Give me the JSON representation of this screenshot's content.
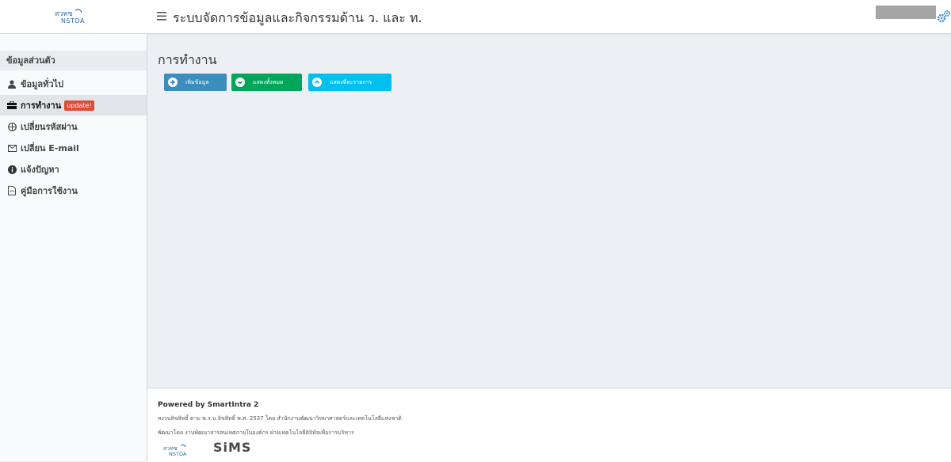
{
  "header": {
    "logo_text": "สวทช NSTDA",
    "menu_icon": "hamburger-icon",
    "title": "ระบบจัดการข้อมูลและกิจกรรมด้าน ว. และ ท.",
    "settings_icon": "gears-icon"
  },
  "sidebar": {
    "header": "ข้อมูลส่วนตัว",
    "items": [
      {
        "label": "ข้อมูลทั่วไป",
        "icon": "user-icon",
        "active": false
      },
      {
        "label": "การทำงาน",
        "icon": "briefcase-icon",
        "active": true,
        "badge": "update!"
      },
      {
        "label": "เปลี่ยนรหัสผ่าน",
        "icon": "globe-lock-icon",
        "active": false
      },
      {
        "label": "เปลี่ยน E-mail",
        "icon": "envelope-icon",
        "active": false
      },
      {
        "label": "แจ้งปัญหา",
        "icon": "info-circle-icon",
        "active": false
      },
      {
        "label": "คู่มือการใช้งาน",
        "icon": "pdf-file-icon",
        "active": false
      }
    ]
  },
  "content": {
    "title": "การทำงาน",
    "buttons": [
      {
        "label": "เพิ่มข้อมูล",
        "icon": "plus-circle-icon",
        "color": "#3c8dbc"
      },
      {
        "label": "แสดงทั้งหมด",
        "icon": "chevron-down-circle-icon",
        "color": "#00a65a"
      },
      {
        "label": "แสดงที่ละรายการ",
        "icon": "chevron-up-circle-icon",
        "color": "#00c0ef"
      }
    ]
  },
  "footer": {
    "powered": "Powered by SmartIntra 2",
    "line1": "สงวนลิขสิทธิ์ ตาม พ.ร.บ.ลิขสิทธิ์ พ.ศ. 2537 โดย สำนักงานพัฒนาวิทยาศาสตร์และเทคโนโลยีแห่งชาติ",
    "line2": "พัฒนาโดย งานพัฒนาสารสนเทศภายในองค์กร ฝ่ายเทคโนโลยีดิจิทัลเพื่อการบริหาร",
    "logo1_text": "สวทช NSTDA",
    "logo2_text": "SiMS"
  }
}
